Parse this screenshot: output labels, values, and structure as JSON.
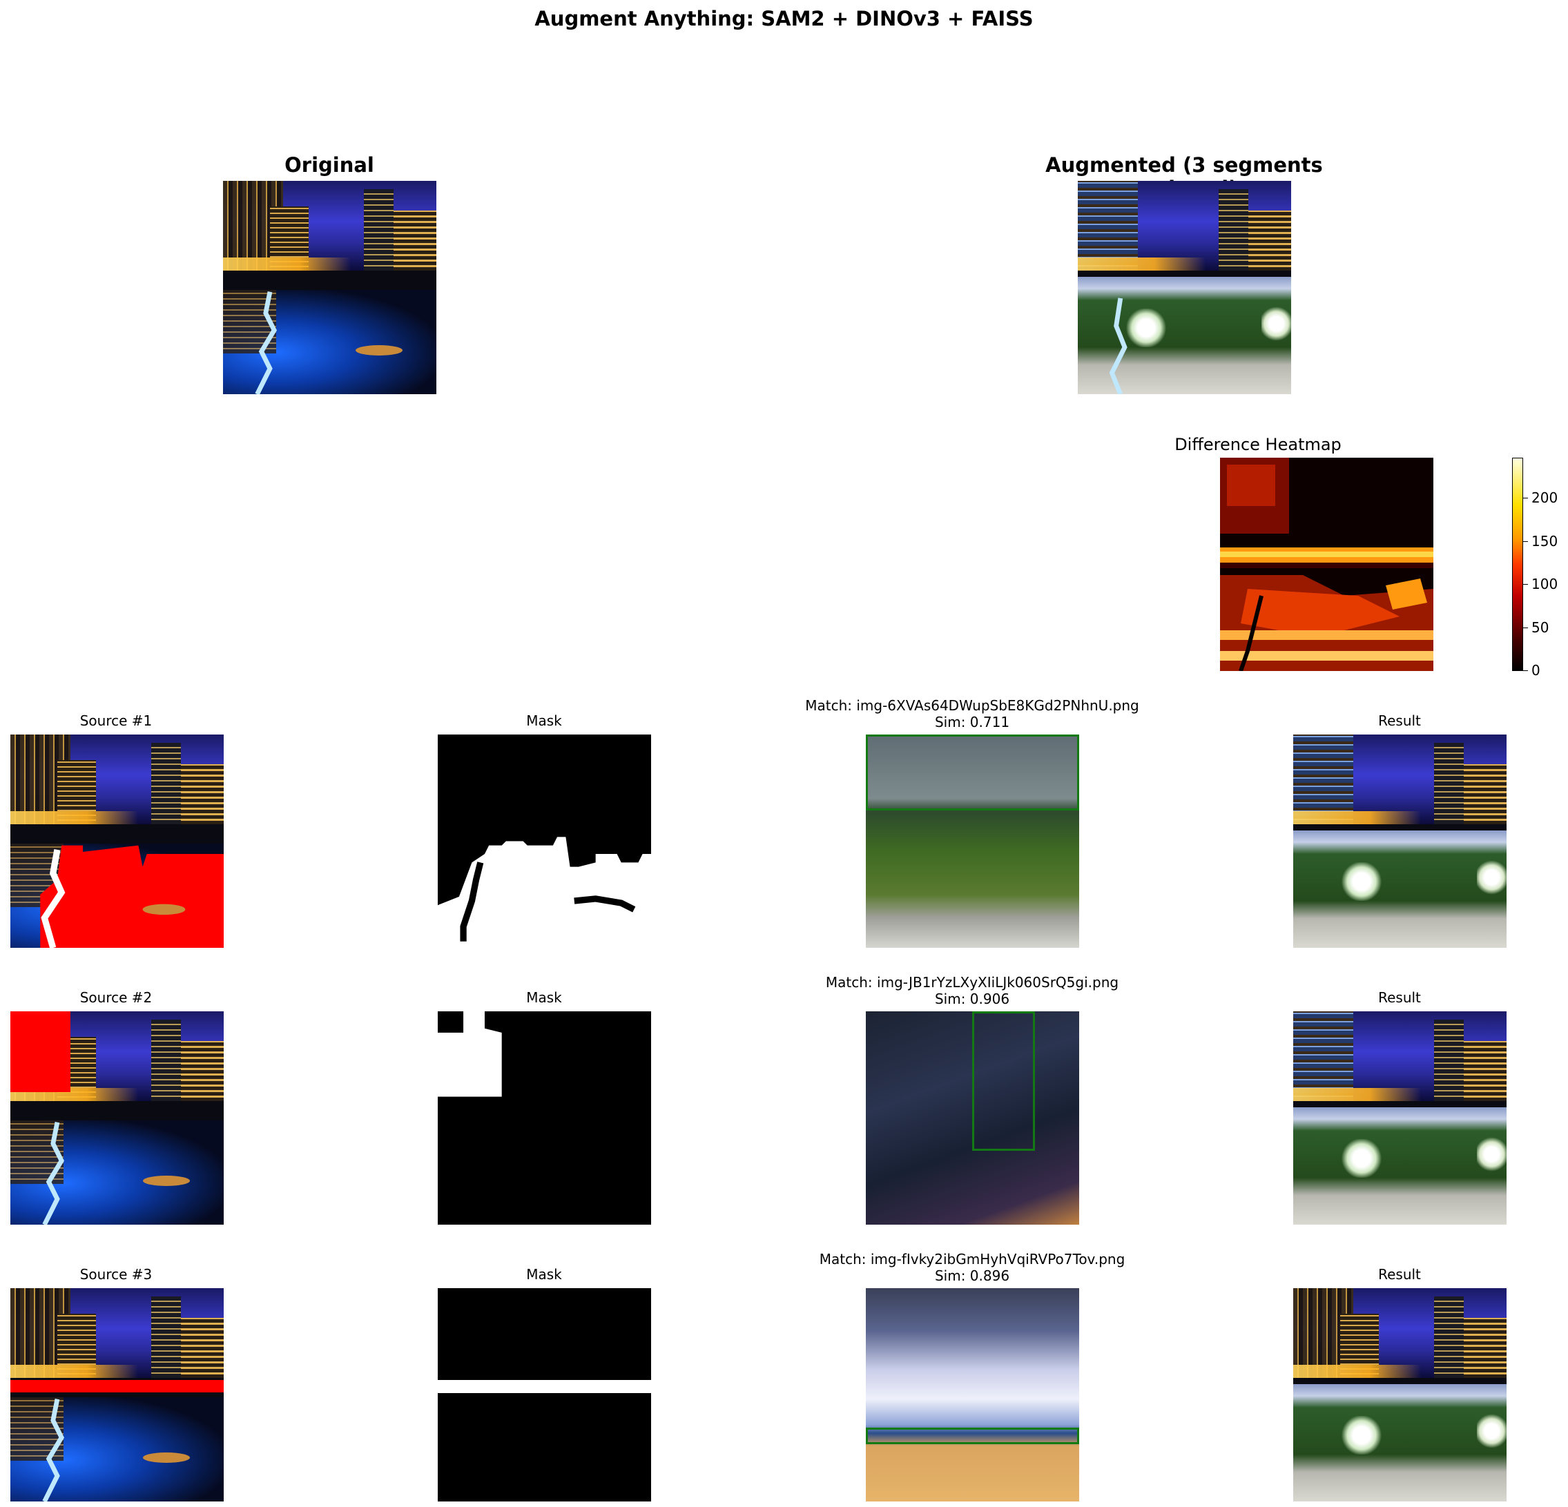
{
  "suptitle": "Augment Anything: SAM2 + DINOv3 + FAISS",
  "top": {
    "original_title": "Original",
    "augmented_title": "Augmented (3 segments replaced)",
    "heatmap_title": "Difference Heatmap",
    "colorbar_ticks": [
      "0",
      "50",
      "100",
      "150",
      "200"
    ]
  },
  "rows": [
    {
      "source_title": "Source #1",
      "mask_title": "Mask",
      "match_title": "Match: img-6XVAs64DWupSbE8KGd2PNhnU.png",
      "match_sim": "Sim: 0.711",
      "result_title": "Result"
    },
    {
      "source_title": "Source #2",
      "mask_title": "Mask",
      "match_title": "Match: img-JB1rYzLXyXIiLJk060SrQ5gi.png",
      "match_sim": "Sim: 0.906",
      "result_title": "Result"
    },
    {
      "source_title": "Source #3",
      "mask_title": "Mask",
      "match_title": "Match: img-fIvky2ibGmHyhVqiRVPo7Tov.png",
      "match_sim": "Sim: 0.896",
      "result_title": "Result"
    }
  ],
  "colors": {
    "mask_highlight": "#ff0000",
    "match_box": "#137a13"
  }
}
